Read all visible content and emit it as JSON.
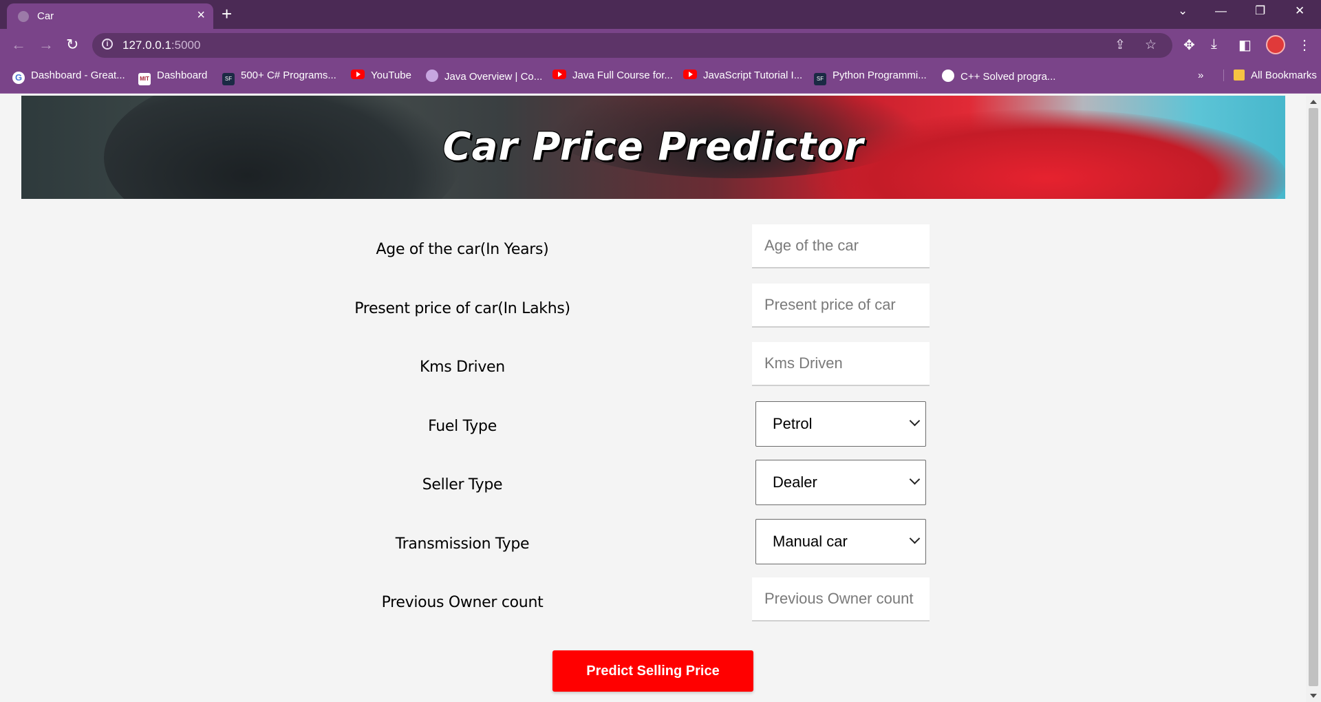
{
  "browser": {
    "tab_title": "Car",
    "tab_close": "×",
    "new_tab": "+",
    "url_host": "127.0.0.1",
    "url_port": ":5000",
    "window_controls": [
      "⌄",
      "—",
      "❐",
      "✕"
    ],
    "bookmarks": [
      {
        "label": "Dashboard - Great...",
        "icon": "google-icon"
      },
      {
        "label": "Dashboard",
        "icon": "mit-icon"
      },
      {
        "label": "500+ C# Programs...",
        "icon": "sf-icon"
      },
      {
        "label": "YouTube",
        "icon": "youtube-icon"
      },
      {
        "label": "Java Overview | Co...",
        "icon": "profile-icon"
      },
      {
        "label": "Java Full Course for...",
        "icon": "youtube-icon"
      },
      {
        "label": "JavaScript Tutorial I...",
        "icon": "youtube-icon"
      },
      {
        "label": "Python Programmi...",
        "icon": "sf-icon"
      },
      {
        "label": "C++ Solved progra...",
        "icon": "globe-icon"
      }
    ],
    "bookmarks_overflow": "»",
    "all_bookmarks": "All Bookmarks"
  },
  "page": {
    "title": "Car Price Predictor",
    "fields": [
      {
        "label": "Age of the car(In Years)",
        "placeholder": "Age of the car"
      },
      {
        "label": "Present price of car(In Lakhs)",
        "placeholder": "Present price of car"
      },
      {
        "label": "Kms Driven",
        "placeholder": "Kms Driven"
      },
      {
        "label": "Fuel Type",
        "selected": "Petrol"
      },
      {
        "label": "Seller Type",
        "selected": "Dealer"
      },
      {
        "label": "Transmission Type",
        "selected": "Manual car"
      },
      {
        "label": "Previous Owner count",
        "placeholder": "Previous Owner count"
      }
    ],
    "submit_label": "Predict Selling Price"
  },
  "colors": {
    "chrome": "#7a4489",
    "tabstrip": "#4b2a55",
    "button": "#ff0000",
    "page_bg": "#f4f4f4"
  }
}
